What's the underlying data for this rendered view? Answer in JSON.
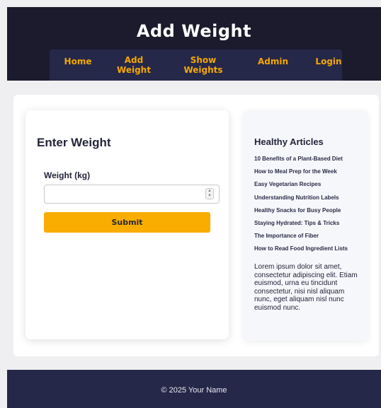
{
  "header": {
    "title": "Add Weight"
  },
  "nav": {
    "items": [
      {
        "line1": "Home",
        "line2": ""
      },
      {
        "line1": "Add",
        "line2": "Weight"
      },
      {
        "line1": "Show",
        "line2": "Weights"
      },
      {
        "line1": "Admin",
        "line2": ""
      },
      {
        "line1": "Login",
        "line2": ""
      }
    ]
  },
  "form": {
    "title": "Enter Weight",
    "weight_label": "Weight (kg)",
    "weight_value": "",
    "submit_label": "Submit"
  },
  "articles": {
    "title": "Healthy Articles",
    "items": [
      "10 Benefits of a Plant-Based Diet",
      "How to Meal Prep for the Week",
      "Easy Vegetarian Recipes",
      "Understanding Nutrition Labels",
      "Healthy Snacks for Busy People",
      "Staying Hydrated: Tips & Tricks",
      "The Importance of Fiber",
      "How to Read Food Ingredient Lists"
    ],
    "body": "Lorem ipsum dolor sit amet, consectetur adipiscing elit. Etiam euismod, urna eu tincidunt consectetur, nisi nisl aliquam nunc, eget aliquam nisl nunc euismod nunc."
  },
  "footer": {
    "text": "© 2025 Your Name"
  },
  "colors": {
    "header_bg": "#1b1b2d",
    "nav_bg": "#262849",
    "accent": "#f8ad00",
    "page_bg": "#efeff1"
  }
}
